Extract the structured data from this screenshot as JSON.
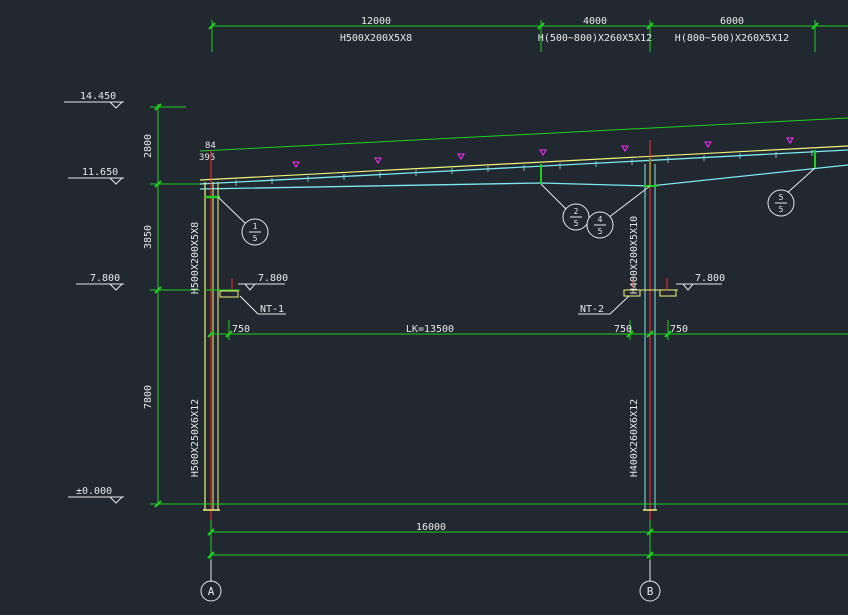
{
  "colors": {
    "background": "#212830",
    "dimension": "#1fd11f",
    "column": "#f2f27a",
    "beam": "#7fe7f0",
    "text": "#e8e8e8",
    "axis": "#ff2a2a",
    "marker": "#ff2dff"
  },
  "top_dimensions": {
    "seg1_value": "12000",
    "seg1_section": "H500X200X5X8",
    "seg2_value": "4000",
    "seg2_section": "H(500~800)X260X5X12",
    "seg3_value": "6000",
    "seg3_section": "H(800~500)X260X5X12"
  },
  "elevations": {
    "level_14450": "14.450",
    "level_11650": "11.650",
    "level_7800_left": "7.800",
    "level_7800_colA": "7.800",
    "level_7800_colB": "7.800",
    "level_0": "±0.000"
  },
  "vertical_dimensions": {
    "d2800": "2800",
    "d3850": "3850",
    "d7800": "7800"
  },
  "slope_label": "84",
  "slope_label_2": "395",
  "columns": {
    "colA_upper": "H500X200X5X8",
    "colA_lower": "H500X250X6X12",
    "colB_upper": "H400X200X5X10",
    "colB_lower": "H400X260X6X12"
  },
  "crane": {
    "nt1": "NT-1",
    "nt2": "NT-2",
    "offset_left": "750",
    "offset_mid": "750",
    "offset_right": "750",
    "span": "LK=13500"
  },
  "bottom_dimension": "16000",
  "axes": {
    "a": "A",
    "b": "B"
  },
  "details": [
    {
      "top": "1",
      "bottom": "5"
    },
    {
      "top": "2",
      "bottom": "5"
    },
    {
      "top": "4",
      "bottom": "5"
    },
    {
      "top": "5",
      "bottom": "5"
    }
  ]
}
